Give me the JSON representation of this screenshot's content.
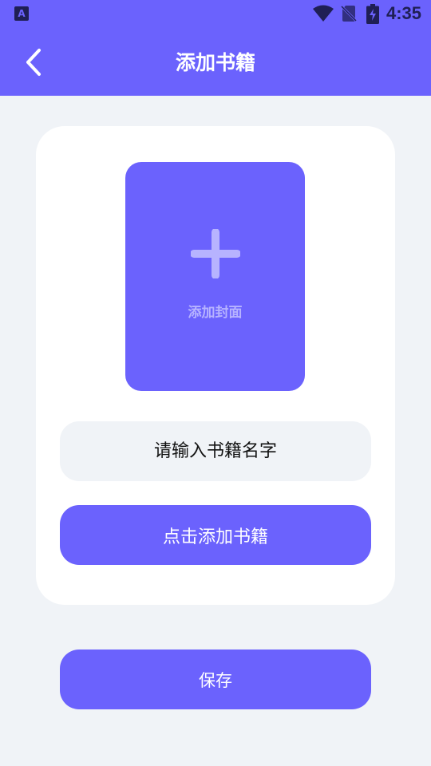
{
  "status_bar": {
    "app_icon_letter": "A",
    "time": "4:35",
    "icons": [
      "app-notification-icon",
      "wifi-icon",
      "no-sim-icon",
      "battery-charging-icon"
    ]
  },
  "header": {
    "title": "添加书籍",
    "back_icon": "chevron-left-icon"
  },
  "cover_picker": {
    "icon": "plus-icon",
    "label": "添加封面"
  },
  "name_input": {
    "value": "",
    "placeholder": "请输入书籍名字"
  },
  "add_book_button": {
    "label": "点击添加书籍"
  },
  "save_button": {
    "label": "保存"
  },
  "colors": {
    "accent": "#6B62FD",
    "background": "#F0F3F7",
    "card": "#FFFFFF",
    "cover_label": "#B7B3FF",
    "status_icons": "#1F1F55"
  }
}
